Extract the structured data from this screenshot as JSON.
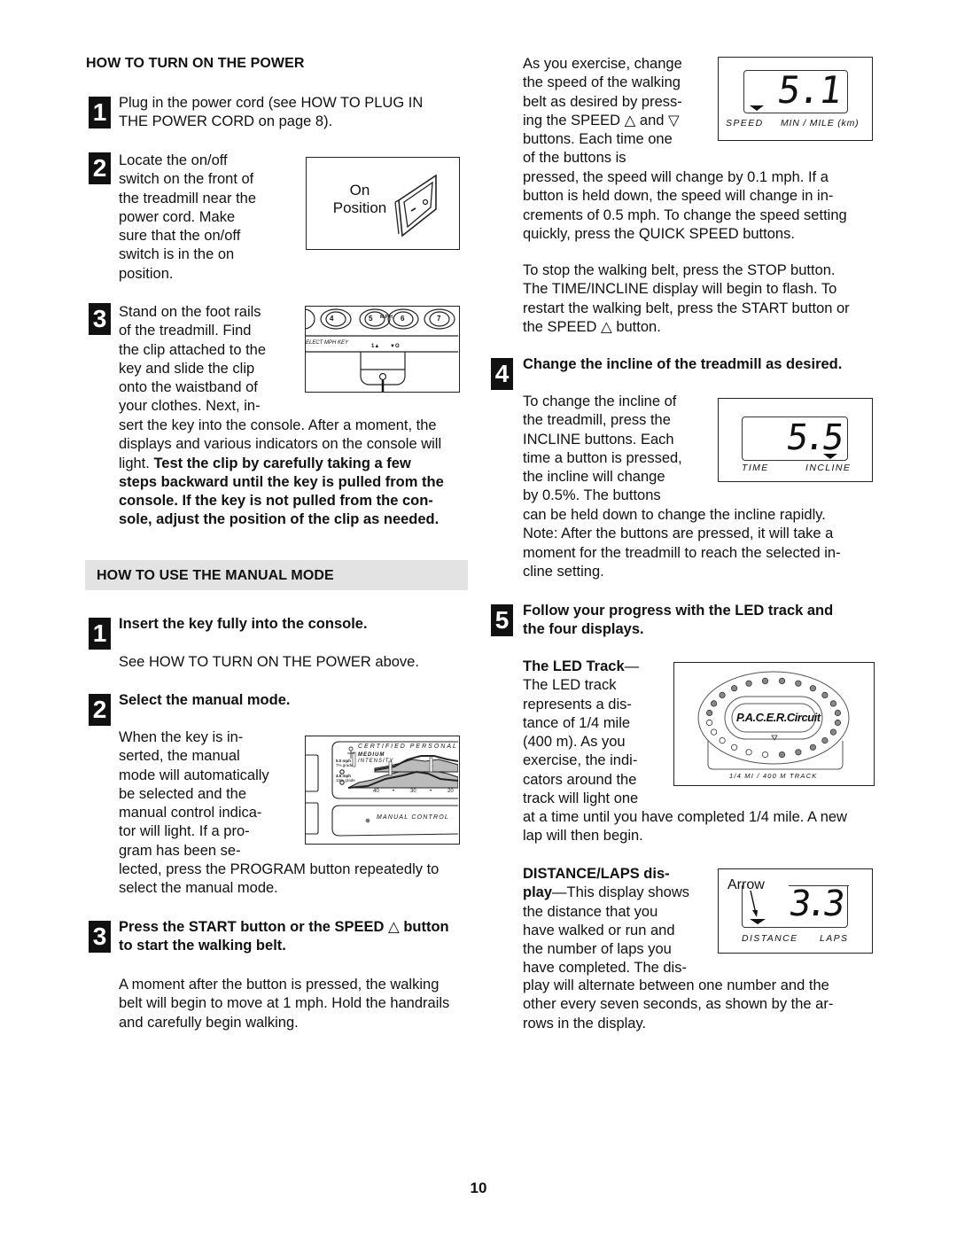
{
  "page_number": "10",
  "left": {
    "power": {
      "heading": "HOW TO TURN ON THE POWER",
      "step1": {
        "num": "1",
        "text": [
          "Plug in the power cord (see HOW TO PLUG IN",
          "THE POWER CORD on page 8)."
        ]
      },
      "step2": {
        "num": "2",
        "text": [
          "Locate the on/off",
          "switch on the front of",
          "the treadmill near the",
          "power cord. Make",
          "sure that the on/off",
          "switch is in the on",
          "position."
        ],
        "figure": {
          "label_line1": "On",
          "label_line2": "Position"
        }
      },
      "step3": {
        "num": "3",
        "text_narrow": [
          "Stand on the foot rails",
          "of the treadmill. Find",
          "the clip attached to the",
          "key and slide the clip",
          "onto the waistband of",
          "your clothes. Next, in-"
        ],
        "text_wide": [
          "sert the key into the console. After a moment, the",
          "displays and various indicators on the console will"
        ],
        "mixed_line_plain": "light. ",
        "mixed_line_bold": "Test the clip by carefully taking a few",
        "bold_lines": [
          "steps backward until the key is pulled from the",
          "console. If the key is not pulled from the con-",
          "sole, adjust the position of the clip as needed."
        ],
        "figure": {
          "keys": [
            "4",
            "5",
            "6",
            "7"
          ],
          "mph_label": "M P H",
          "select_label": "ELECT MPH KEY",
          "indicator_labels": [
            "1▲",
            "▼O"
          ]
        }
      }
    },
    "manual": {
      "heading": "HOW TO USE THE MANUAL MODE",
      "step1": {
        "num": "1",
        "title": "Insert the key fully into the console.",
        "text": "See HOW TO TURN ON THE POWER above."
      },
      "step2": {
        "num": "2",
        "title": "Select the manual mode.",
        "text_narrow": [
          "When the key is in-",
          "serted, the manual",
          "mode will automatically",
          "be selected and the",
          "manual control indica-",
          "tor will light. If a pro-",
          "gram has been se-"
        ],
        "text_wide": [
          "lected, press the PROGRAM button repeatedly to",
          "select the manual mode."
        ],
        "figure": {
          "certified": "CERTIFIED PERSONAL",
          "intensity1": "MEDIUM",
          "intensity2": "INTENSITY",
          "speed1": "5.0 mph",
          "grade1": "7% grade",
          "speed2": "4.5 mph",
          "grade2": "10% grade",
          "axis": [
            "40",
            "•",
            "30",
            "•",
            "20"
          ],
          "manual_control": "MANUAL CONTROL"
        }
      },
      "step3": {
        "num": "3",
        "title": [
          "Press the START button or the SPEED △ button",
          "to start the walking belt."
        ],
        "text": [
          "A moment after the button is pressed, the walking",
          "belt will begin to move at 1 mph. Hold the handrails",
          "and carefully begin walking."
        ]
      }
    }
  },
  "right": {
    "speed_para": {
      "text_narrow": [
        "As you exercise, change",
        "the speed of the walking",
        "belt as desired by press-",
        "ing the SPEED △ and ▽",
        "buttons. Each time one",
        "of the buttons is"
      ],
      "text_wide": [
        "pressed, the speed will change by 0.1 mph. If a",
        "button is held down, the speed will change in in-",
        "crements of 0.5 mph. To change the speed setting",
        "quickly, press the QUICK SPEED buttons."
      ],
      "display": {
        "value": "5.1",
        "label_left": "SPEED",
        "label_right": "MIN / MILE (km)"
      }
    },
    "stop_para": [
      "To stop the walking belt, press the STOP button.",
      "The TIME/INCLINE display will begin to flash. To",
      "restart the walking belt, press the START button or",
      "the SPEED △ button."
    ],
    "step4": {
      "num": "4",
      "title": "Change the incline of the treadmill as desired.",
      "text_narrow": [
        "To change the incline of",
        "the treadmill, press the",
        "INCLINE buttons. Each",
        "time a button is pressed,",
        "the incline will change",
        "by 0.5%. The buttons"
      ],
      "text_wide": [
        "can be held down to change the incline rapidly.",
        "Note: After the buttons are pressed, it will take a",
        "moment for the treadmill to reach the selected in-",
        "cline setting."
      ],
      "display": {
        "value": "5.5",
        "label_left": "TIME",
        "label_right": "INCLINE"
      }
    },
    "step5": {
      "num": "5",
      "title": [
        "Follow your progress with the LED track and",
        "the four displays."
      ],
      "led": {
        "title": "The LED Track",
        "dash": "—",
        "text_narrow": [
          "The LED track",
          "represents a dis-",
          "tance of 1/4 mile",
          "(400 m). As you",
          "exercise, the indi-",
          "cators around the",
          "track will light one"
        ],
        "text_wide": [
          "at a time until you have completed 1/4 mile. A new",
          "lap will then begin."
        ],
        "figure": {
          "logo": "P.A.C.E.R.Circuit",
          "caption": "1/4 MI / 400 M TRACK",
          "lit_count": 18,
          "total_count": 24
        }
      },
      "distance": {
        "title1": "DISTANCE/LAPS dis-",
        "title2": "play",
        "text_first": "—This display shows",
        "text_narrow": [
          "the distance that you",
          "have walked or run and",
          "the number of laps you",
          "have completed. The dis-"
        ],
        "text_wide": [
          "play will alternate between one number and the",
          "other every seven seconds, as shown by the ar-",
          "rows in the display."
        ],
        "display": {
          "value": "3.3",
          "arrow_label": "Arrow",
          "label_left": "DISTANCE",
          "label_right": "LAPS"
        }
      }
    }
  }
}
